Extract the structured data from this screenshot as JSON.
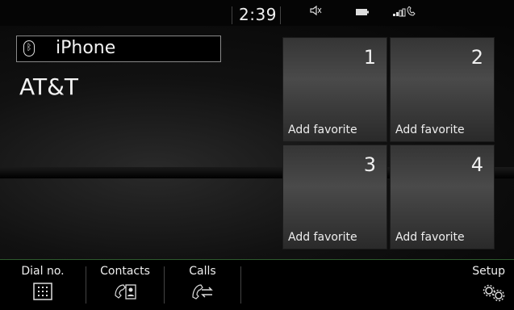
{
  "status": {
    "time": "2:39",
    "mute_icon": "speaker-muted-icon",
    "battery_icon": "battery-icon",
    "signal_icon": "signal-phone-icon"
  },
  "device": {
    "bt_icon": "bluetooth-icon",
    "name": "iPhone",
    "carrier": "AT&T"
  },
  "favorites": [
    {
      "number": "1",
      "label": "Add favorite"
    },
    {
      "number": "2",
      "label": "Add favorite"
    },
    {
      "number": "3",
      "label": "Add favorite"
    },
    {
      "number": "4",
      "label": "Add favorite"
    }
  ],
  "tabs": {
    "dial": {
      "label": "Dial no.",
      "icon": "keypad-icon"
    },
    "contacts": {
      "label": "Contacts",
      "icon": "contacts-icon"
    },
    "calls": {
      "label": "Calls",
      "icon": "calls-icon"
    },
    "setup": {
      "label": "Setup",
      "icon": "gears-icon"
    }
  },
  "colors": {
    "accent_line": "#2d5a2d",
    "tile": "#404040"
  }
}
